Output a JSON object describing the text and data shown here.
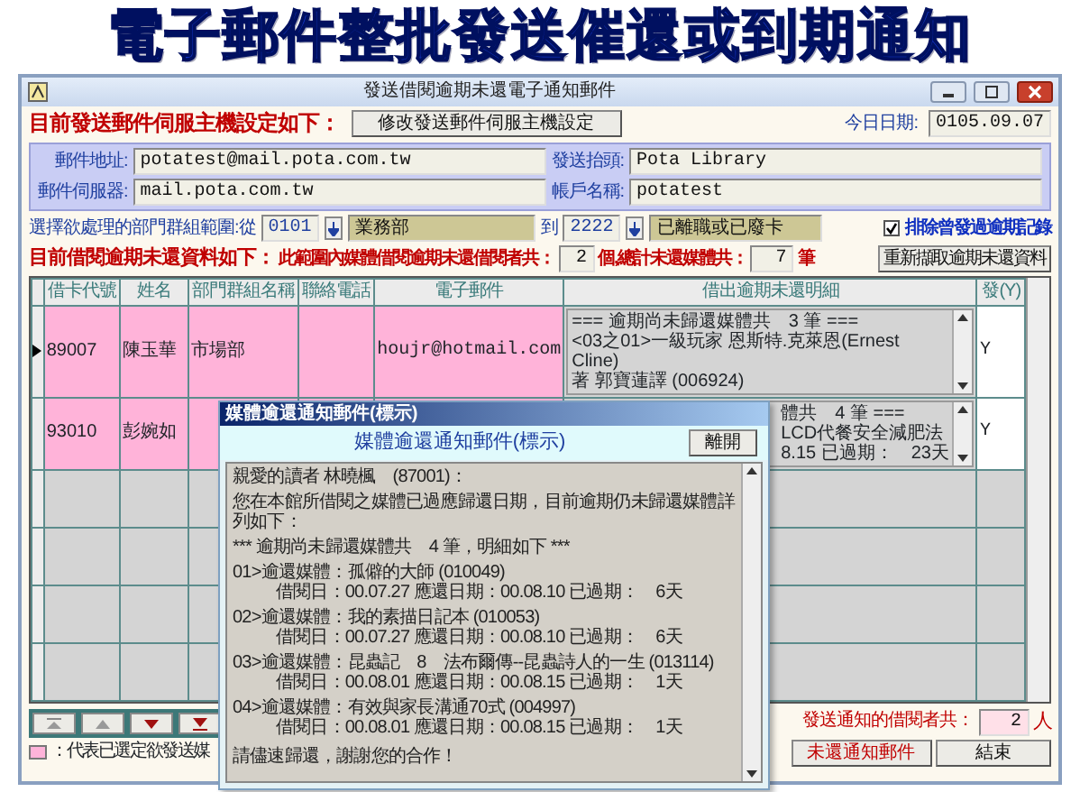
{
  "banner": {
    "title": "電子郵件整批發送催還或到期通知"
  },
  "window": {
    "title": "發送借閱逾期未還電子通知郵件"
  },
  "server_settings": {
    "label": "目前發送郵件伺服主機設定如下：",
    "edit_button": "修改發送郵件伺服主機設定",
    "today_label": "今日日期:",
    "today": "0105.09.07",
    "fields": [
      {
        "label": "郵件地址:",
        "value": "potatest@mail.pota.com.tw"
      },
      {
        "label": "發送抬頭:",
        "value": "Pota Library"
      },
      {
        "label": "郵件伺服器:",
        "value": "mail.pota.com.tw"
      },
      {
        "label": "帳戶名稱:",
        "value": "potatest"
      }
    ]
  },
  "range": {
    "label": "選擇欲處理的部門群組範圍:從",
    "from_code": "0101",
    "from_name": "業務部",
    "to_label": "到",
    "to_code": "2222",
    "to_name": "已離職或已廢卡",
    "exclude": {
      "label": "排除曾發過逾期記錄",
      "checked": true
    }
  },
  "summary": {
    "label": "目前借閱逾期未還資料如下：",
    "borrowers_label": "此範圍內媒體借閱逾期未還借閱者共：",
    "borrowers": "2",
    "items_label": "個,總計未還媒體共：",
    "items": "7",
    "items_unit": "筆",
    "refresh_button": "重新擷取逾期未還資料"
  },
  "table": {
    "columns": [
      "借卡代號",
      "姓名",
      "部門群組名稱",
      "聯絡電話",
      "電子郵件",
      "借出逾期未還明細",
      "發(Y)"
    ],
    "rows": [
      {
        "id": "89007",
        "name": "陳玉華",
        "dept": "市場部",
        "email": "houjr@hotmail.com",
        "details": [
          "=== 逾期尚未歸還媒體共　3 筆 ===",
          "<03之01>一級玩家 恩斯特.克萊恩(Ernest Cline)",
          "著 郭寶蓮譯 (006924)"
        ],
        "send": "Y",
        "marked": true,
        "current": true
      },
      {
        "id": "93010",
        "name": "彭婉如",
        "details": [
          "體共　4 筆 ===",
          "LCD代餐安全減肥法",
          "8.15 已過期：　23天"
        ],
        "send": "Y",
        "marked": true,
        "current": false
      }
    ]
  },
  "legend": {
    "text": "：代表已選定欲發送媒"
  },
  "footer": {
    "count_label": "發送通知的借閱者共：",
    "count": "2",
    "count_unit": "人",
    "send_button": "未還通知郵件",
    "close_button": "結束"
  },
  "dialog": {
    "window_title": "媒體逾還通知郵件(標示)",
    "heading": "媒體逾還通知郵件(標示)",
    "close_button": "離開",
    "greeting": "親愛的讀者 林曉楓　(87001)：",
    "intro": "您在本館所借閱之媒體已過應歸還日期，目前逾期仍未歸還媒體詳列如下：",
    "summary": "*** 逾期尚未歸還媒體共　4 筆，明細如下 ***",
    "items": [
      {
        "title": "01>逾還媒體：孤僻的大師 (010049)",
        "detail": "借閱日：00.07.27 應還日期：00.08.10 已過期：　6天"
      },
      {
        "title": "02>逾還媒體：我的素描日記本 (010053)",
        "detail": "借閱日：00.07.27 應還日期：00.08.10 已過期：　6天"
      },
      {
        "title": "03>逾還媒體：昆蟲記　8　法布爾傳--昆蟲詩人的一生 (013114)",
        "detail": "借閱日：00.08.01 應還日期：00.08.15 已過期：　1天"
      },
      {
        "title": "04>逾還媒體：有效與家長溝通70式 (004997)",
        "detail": "借閱日：00.08.01 應還日期：00.08.15 已過期：　1天"
      }
    ],
    "closing": "請儘速歸還，謝謝您的合作！"
  }
}
